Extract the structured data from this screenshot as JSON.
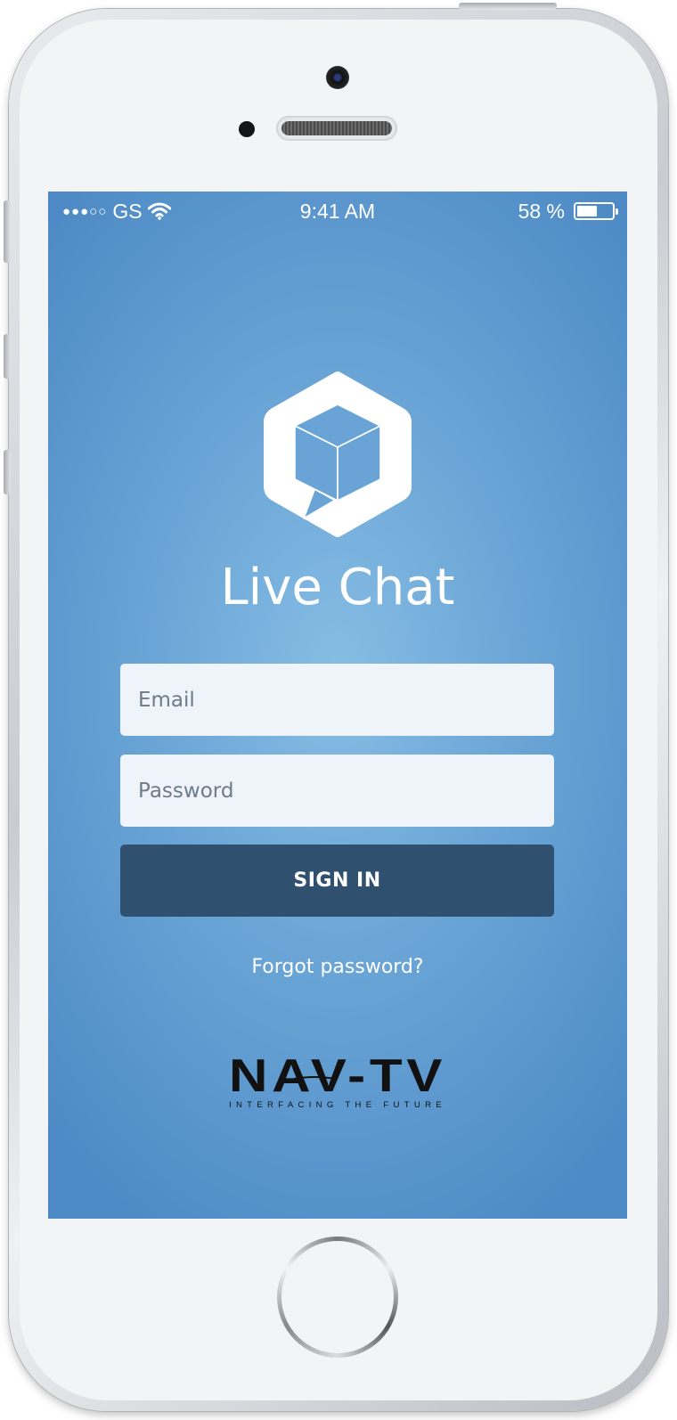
{
  "status_bar": {
    "signal": "●●●○○",
    "carrier": "GS",
    "time": "9:41 AM",
    "battery_text": "58 %",
    "battery_level": 0.58
  },
  "app": {
    "title": "Live Chat",
    "logo_icon": "hexagon-cube-chat-bubble"
  },
  "login_form": {
    "email_placeholder": "Email",
    "password_placeholder": "Password",
    "email_value": "",
    "password_value": "",
    "signin_label": "SIGN IN",
    "forgot_label": "Forgot password?"
  },
  "brand": {
    "name": "NAV-TV",
    "tagline": "INTERFACING THE FUTURE"
  },
  "colors": {
    "background_center": "#86bde4",
    "background_edge": "#4d8ac5",
    "button": "#30506f",
    "field": "#eff4fa"
  }
}
